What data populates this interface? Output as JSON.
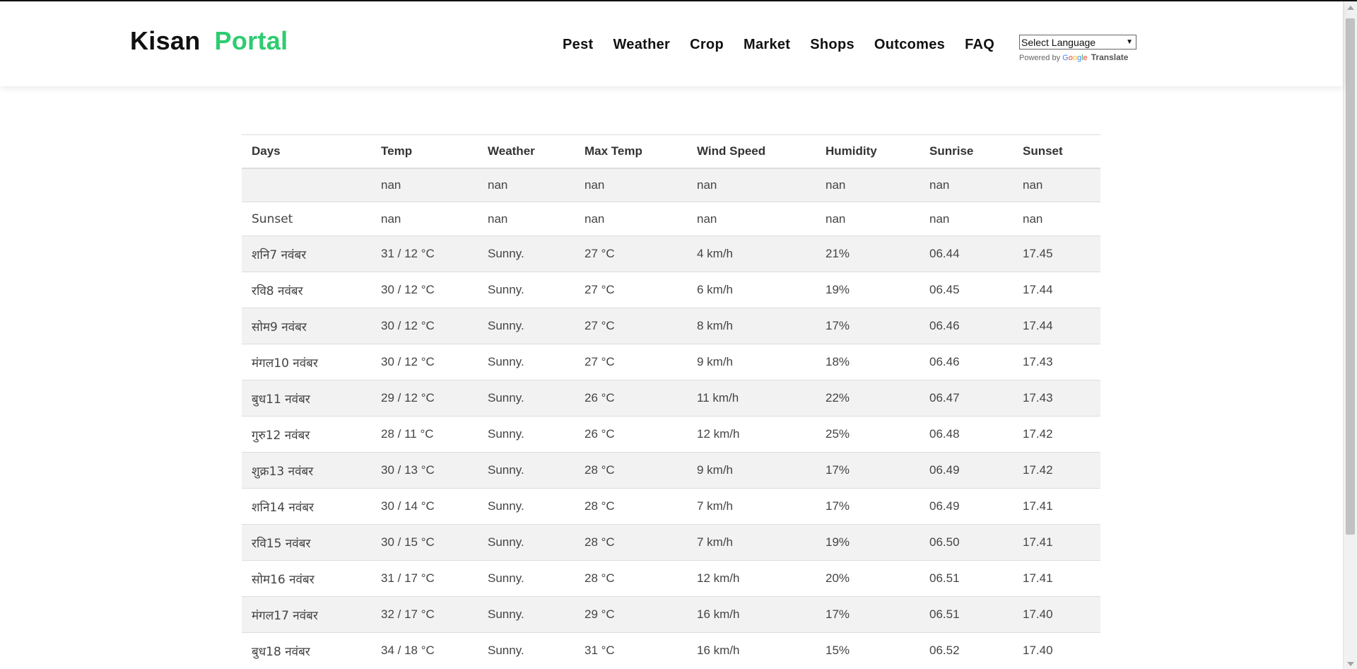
{
  "brand": {
    "part1": "Kisan",
    "part2": "Portal",
    "accent": "#2ecc71"
  },
  "nav": [
    "Pest",
    "Weather",
    "Crop",
    "Market",
    "Shops",
    "Outcomes",
    "FAQ"
  ],
  "translate": {
    "select_label": "Select Language",
    "powered_by": "Powered by",
    "google": [
      "G",
      "o",
      "o",
      "g",
      "l",
      "e"
    ],
    "translate_label": "Translate"
  },
  "table": {
    "headers": [
      "Days",
      "Temp",
      "Weather",
      "Max Temp",
      "Wind Speed",
      "Humidity",
      "Sunrise",
      "Sunset"
    ],
    "rows": [
      [
        "",
        "nan",
        "nan",
        "nan",
        "nan",
        "nan",
        "nan",
        "nan"
      ],
      [
        "Sunset",
        "nan",
        "nan",
        "nan",
        "nan",
        "nan",
        "nan",
        "nan"
      ],
      [
        "शनि7 नवंबर",
        "31 / 12 °C",
        "Sunny.",
        "27 °C",
        "4 km/h",
        "21%",
        "06.44",
        "17.45"
      ],
      [
        "रवि8 नवंबर",
        "30 / 12 °C",
        "Sunny.",
        "27 °C",
        "6 km/h",
        "19%",
        "06.45",
        "17.44"
      ],
      [
        "सोम9 नवंबर",
        "30 / 12 °C",
        "Sunny.",
        "27 °C",
        "8 km/h",
        "17%",
        "06.46",
        "17.44"
      ],
      [
        "मंगल10 नवंबर",
        "30 / 12 °C",
        "Sunny.",
        "27 °C",
        "9 km/h",
        "18%",
        "06.46",
        "17.43"
      ],
      [
        "बुध11 नवंबर",
        "29 / 12 °C",
        "Sunny.",
        "26 °C",
        "11 km/h",
        "22%",
        "06.47",
        "17.43"
      ],
      [
        "गुरु12 नवंबर",
        "28 / 11 °C",
        "Sunny.",
        "26 °C",
        "12 km/h",
        "25%",
        "06.48",
        "17.42"
      ],
      [
        "शुक्र13 नवंबर",
        "30 / 13 °C",
        "Sunny.",
        "28 °C",
        "9 km/h",
        "17%",
        "06.49",
        "17.42"
      ],
      [
        "शनि14 नवंबर",
        "30 / 14 °C",
        "Sunny.",
        "28 °C",
        "7 km/h",
        "17%",
        "06.49",
        "17.41"
      ],
      [
        "रवि15 नवंबर",
        "30 / 15 °C",
        "Sunny.",
        "28 °C",
        "7 km/h",
        "19%",
        "06.50",
        "17.41"
      ],
      [
        "सोम16 नवंबर",
        "31 / 17 °C",
        "Sunny.",
        "28 °C",
        "12 km/h",
        "20%",
        "06.51",
        "17.41"
      ],
      [
        "मंगल17 नवंबर",
        "32 / 17 °C",
        "Sunny.",
        "29 °C",
        "16 km/h",
        "17%",
        "06.51",
        "17.40"
      ],
      [
        "बुध18 नवंबर",
        "34 / 18 °C",
        "Sunny.",
        "31 °C",
        "16 km/h",
        "15%",
        "06.52",
        "17.40"
      ]
    ]
  }
}
